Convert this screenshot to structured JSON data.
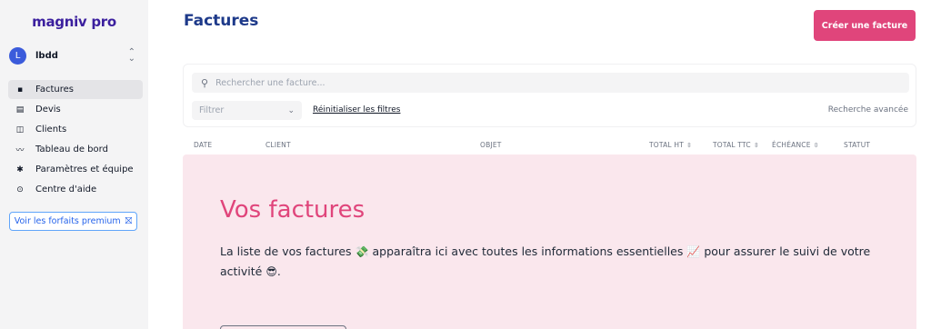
{
  "sidebar": {
    "logo": "magniv pro",
    "org": {
      "initial": "L",
      "name": "lbdd",
      "chevron": "⌃\n⌄"
    },
    "items": [
      {
        "label": "Factures",
        "icon": "file-icon",
        "glyph": "▪"
      },
      {
        "label": "Devis",
        "icon": "document-icon",
        "glyph": "▤"
      },
      {
        "label": "Clients",
        "icon": "contact-icon",
        "glyph": "◫"
      },
      {
        "label": "Tableau de bord",
        "icon": "chart-line-icon",
        "glyph": "〰"
      },
      {
        "label": "Paramètres et équipe",
        "icon": "gear-icon",
        "glyph": "✱"
      },
      {
        "label": "Centre d'aide",
        "icon": "help-icon",
        "glyph": "⊙"
      }
    ],
    "active_index": 0,
    "premium_label": "Voir les forfaits premium",
    "premium_icon": "gift-icon"
  },
  "header": {
    "title": "Factures",
    "create_label": "Créer une facture"
  },
  "filters": {
    "search_placeholder": "Rechercher une facture...",
    "filter_placeholder": "Filtrer",
    "reset_label": "Réinitialiser les filtres",
    "advanced_label": "Recherche avancée"
  },
  "table": {
    "columns": [
      "DATE",
      "CLIENT",
      "OBJET",
      "TOTAL HT",
      "TOTAL TTC",
      "ÉCHÉANCE",
      "STATUT"
    ],
    "sort_glyph": "⌃⌄"
  },
  "empty_state": {
    "title": "Vos factures",
    "text_1": "La liste de vos factures",
    "emoji_1": "💸",
    "text_2": "apparaîtra ici avec toutes les informations essentielles",
    "emoji_2": "📈",
    "text_3": "pour assurer le suivi de votre activité",
    "emoji_3": "😎",
    "text_4": "."
  },
  "colors": {
    "brand": "#3b1f9e",
    "accent": "#e0457b",
    "title": "#1e3a8a",
    "empty_bg": "#fae7ed"
  }
}
